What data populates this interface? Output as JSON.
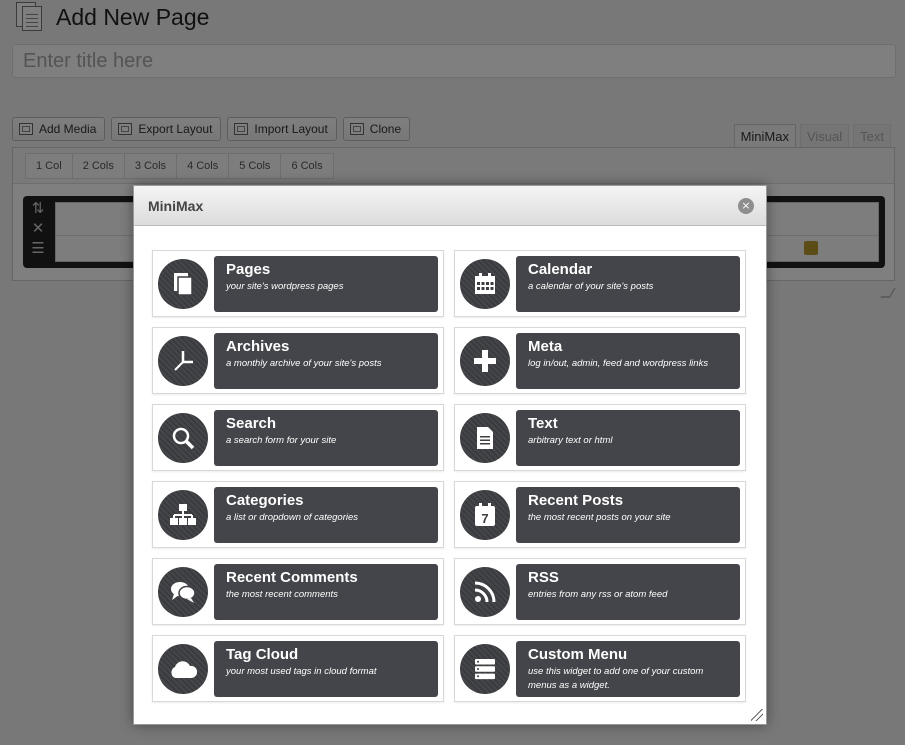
{
  "page": {
    "title": "Add New Page",
    "title_placeholder": "Enter title here"
  },
  "toolbar": [
    {
      "label": "Add Media",
      "icon": "media-icon"
    },
    {
      "label": "Export Layout",
      "icon": "export-icon"
    },
    {
      "label": "Import Layout",
      "icon": "import-icon"
    },
    {
      "label": "Clone",
      "icon": "clone-icon"
    }
  ],
  "editor_tabs": [
    {
      "label": "MiniMax",
      "active": true
    },
    {
      "label": "Visual",
      "active": false
    },
    {
      "label": "Text",
      "active": false
    }
  ],
  "column_buttons": [
    "1 Col",
    "2 Cols",
    "3 Cols",
    "4 Cols",
    "5 Cols",
    "6 Cols"
  ],
  "modal": {
    "title": "MiniMax",
    "close_glyph": "×",
    "widgets": [
      {
        "name": "Pages",
        "desc": "your site's wordpress pages",
        "icon": "pages-icon"
      },
      {
        "name": "Calendar",
        "desc": "a calendar of your site's posts",
        "icon": "calendar-icon"
      },
      {
        "name": "Archives",
        "desc": "a monthly archive of your site's posts",
        "icon": "clock-icon"
      },
      {
        "name": "Meta",
        "desc": "log in/out, admin, feed and wordpress links",
        "icon": "plus-icon"
      },
      {
        "name": "Search",
        "desc": "a search form for your site",
        "icon": "search-icon"
      },
      {
        "name": "Text",
        "desc": "arbitrary text or html",
        "icon": "document-icon"
      },
      {
        "name": "Categories",
        "desc": "a list or dropdown of categories",
        "icon": "sitemap-icon"
      },
      {
        "name": "Recent Posts",
        "desc": "the most recent posts on your site",
        "icon": "date-icon"
      },
      {
        "name": "Recent Comments",
        "desc": "the most recent comments",
        "icon": "comments-icon"
      },
      {
        "name": "RSS",
        "desc": "entries from any rss or atom feed",
        "icon": "rss-icon"
      },
      {
        "name": "Tag Cloud",
        "desc": "your most used tags in cloud format",
        "icon": "cloud-icon"
      },
      {
        "name": "Custom Menu",
        "desc": "use this widget to add one of your custom menus as a widget.",
        "icon": "menu-icon"
      }
    ]
  },
  "recent_posts_day": "7"
}
